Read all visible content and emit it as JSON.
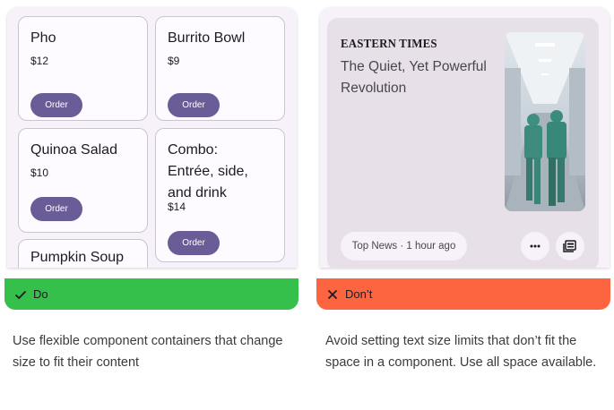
{
  "do_example": {
    "menu_items": [
      {
        "name": "Pho",
        "price": "$12",
        "button": "Order"
      },
      {
        "name": "Burrito Bowl",
        "price": "$9",
        "button": "Order"
      },
      {
        "name": "Quinoa Salad",
        "price": "$10",
        "button": "Order"
      },
      {
        "name": "Combo: Entrée, side, and drink",
        "price": "$14",
        "button": "Order"
      },
      {
        "name": "Pumpkin Soup"
      }
    ],
    "colors": {
      "panel_bg": "#f7f2fa",
      "card_border": "#cac4d0",
      "button_bg": "#6a5c96"
    }
  },
  "dont_example": {
    "source": "EASTERN TIMES",
    "headline": "The Quiet, Yet Powerful Revolution",
    "meta": "Top News · 1 hour ago",
    "icons": [
      "more-horiz-icon",
      "newspaper-icon"
    ],
    "colors": {
      "card_bg": "#e7e0e8",
      "chip_bg": "#f7f2fa"
    }
  },
  "do_banner": {
    "label": "Do",
    "icon": "check-icon",
    "color": "#34c04a"
  },
  "dont_banner": {
    "label": "Don’t",
    "icon": "close-icon",
    "color": "#fd6541"
  },
  "do_caption": "Use flexible component containers that change size to fit their content",
  "dont_caption": "Avoid setting text size limits that don’t fit the space in a component. Use all space available."
}
